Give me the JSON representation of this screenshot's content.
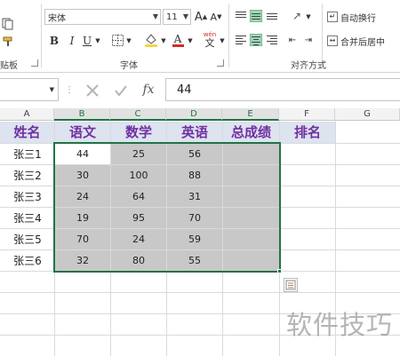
{
  "ribbon": {
    "font_name": "宋体",
    "font_size": "11",
    "grow_font": "A",
    "shrink_font": "A",
    "bold": "B",
    "italic": "I",
    "underline": "U",
    "wen_label": "wén",
    "wen_glyph": "文",
    "clipboard_group": "贴板",
    "font_group": "字体",
    "alignment_group": "对齐方式",
    "wrap_text": "自动换行",
    "merge_center": "合并后居中",
    "font_color_accent": "#d42b2b",
    "fill_color_accent": "#f1d64a"
  },
  "formula_bar": {
    "cancel_icon": "x-icon",
    "enter_icon": "check-icon",
    "fx": "fx",
    "value": "44"
  },
  "columns": [
    "A",
    "B",
    "C",
    "D",
    "E",
    "F",
    "G"
  ],
  "table": {
    "headers": [
      "姓名",
      "语文",
      "数学",
      "英语",
      "总成绩",
      "排名"
    ],
    "rows": [
      {
        "name": "张三1",
        "values": [
          "44",
          "25",
          "56"
        ]
      },
      {
        "name": "张三2",
        "values": [
          "30",
          "100",
          "88"
        ]
      },
      {
        "name": "张三3",
        "values": [
          "24",
          "64",
          "31"
        ]
      },
      {
        "name": "张三4",
        "values": [
          "19",
          "95",
          "70"
        ]
      },
      {
        "name": "张三5",
        "values": [
          "70",
          "24",
          "59"
        ]
      },
      {
        "name": "张三6",
        "values": [
          "32",
          "80",
          "55"
        ]
      }
    ]
  },
  "colors": {
    "header_fill": "#dde3ef",
    "header_text": "#7030a0",
    "selection_fill": "#c8c8c8",
    "selection_border": "#217346"
  },
  "watermark": "软件技巧"
}
